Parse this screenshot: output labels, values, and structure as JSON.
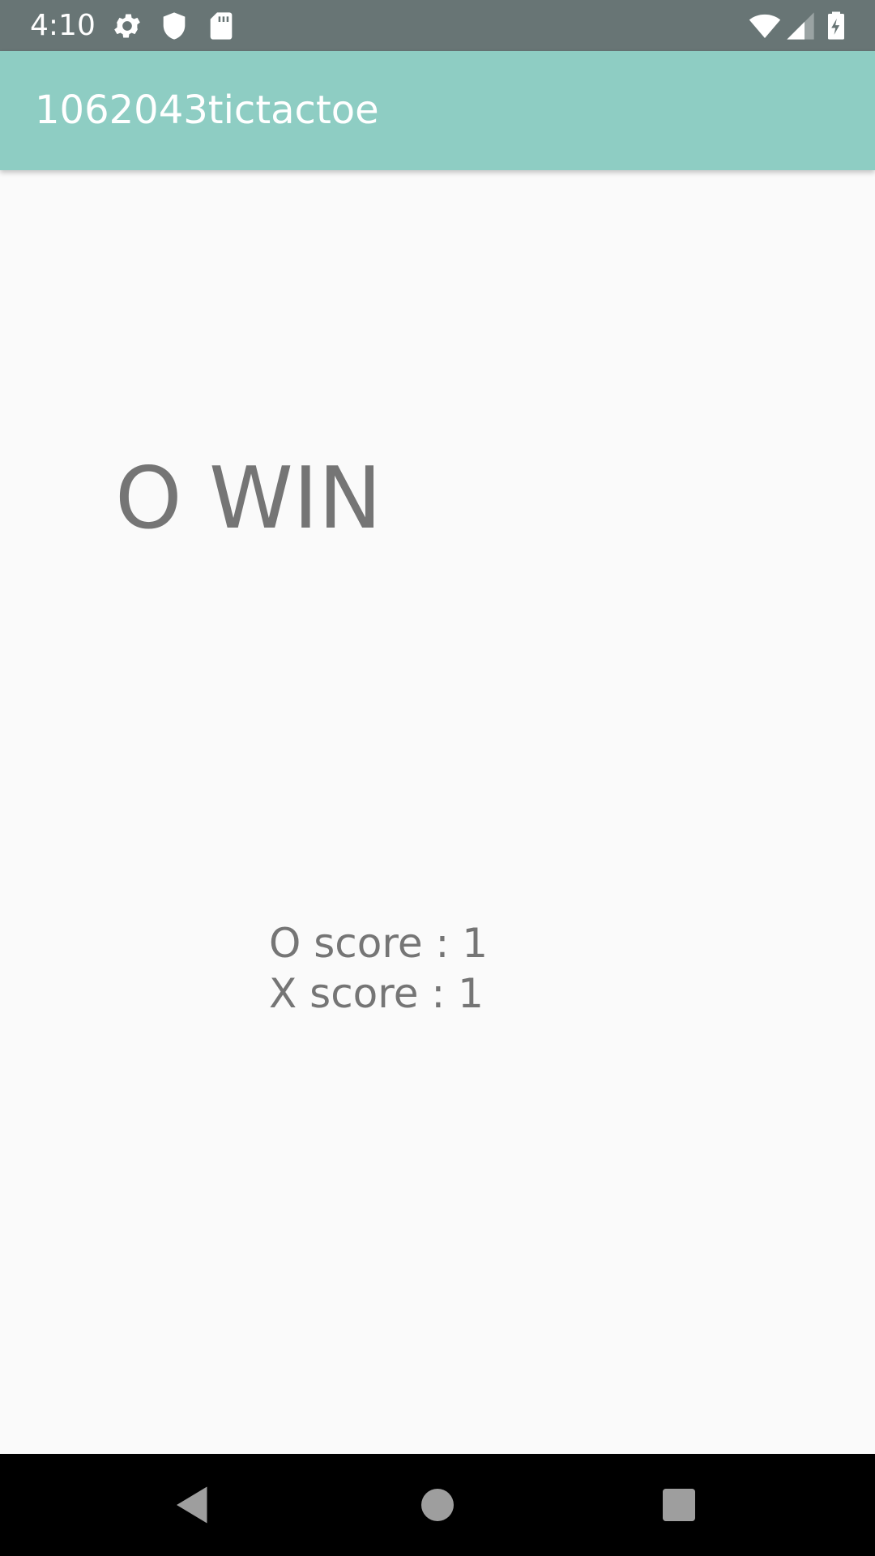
{
  "status_bar": {
    "time": "4:10",
    "left_icons": [
      "gear-icon",
      "shield-icon",
      "sd-card-icon"
    ],
    "right_icons": [
      "wifi-icon",
      "cell-signal-icon",
      "battery-charging-icon"
    ]
  },
  "app_bar": {
    "title": "1062043tictactoe",
    "background_color": "#8ecdc3"
  },
  "game": {
    "result": "O WIN",
    "o_score": "O score : 1",
    "x_score": "X score : 1"
  },
  "nav_bar": {
    "buttons": [
      "back-icon",
      "home-icon",
      "recents-icon"
    ]
  }
}
